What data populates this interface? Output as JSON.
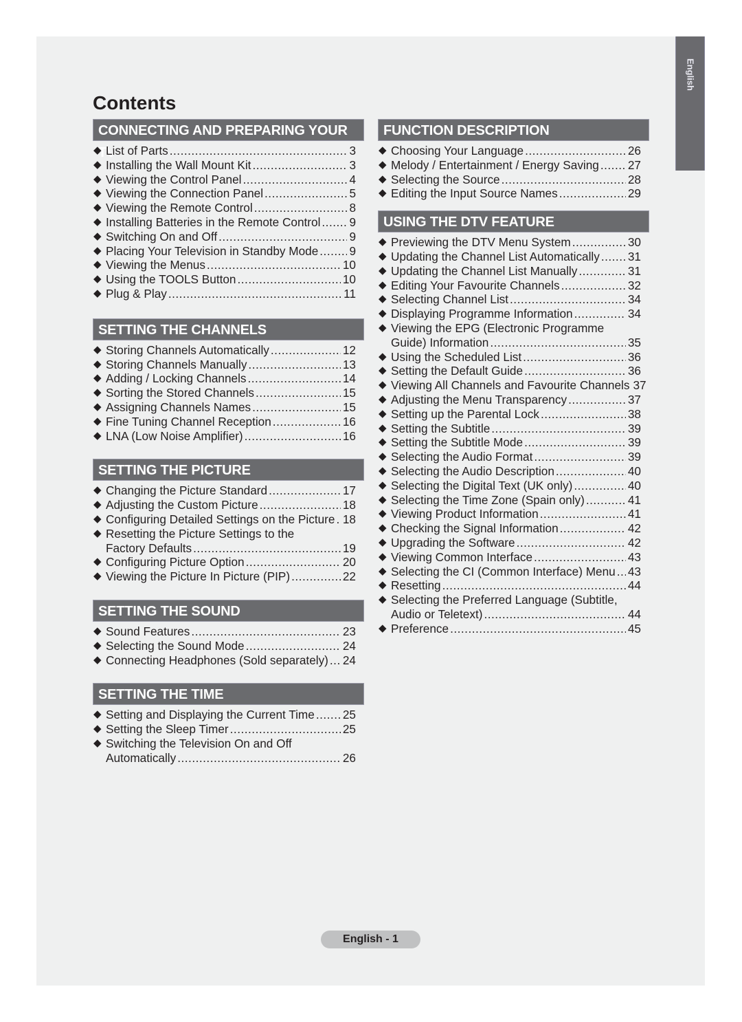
{
  "side_tab": "English",
  "title": "Contents",
  "footer": "English - 1",
  "left_sections": [
    {
      "heading": "CONNECTING AND PREPARING YOUR TV",
      "items": [
        {
          "text": "List of Parts",
          "page": "3"
        },
        {
          "text": "Installing the Wall Mount Kit",
          "page": "3"
        },
        {
          "text": "Viewing the Control Panel",
          "page": "4"
        },
        {
          "text": "Viewing the Connection Panel",
          "page": "5"
        },
        {
          "text": "Viewing the Remote Control",
          "page": "8"
        },
        {
          "text": "Installing Batteries in the Remote Control",
          "page": "9"
        },
        {
          "text": "Switching On and Off",
          "page": "9"
        },
        {
          "text": "Placing Your Television in Standby Mode",
          "page": "9"
        },
        {
          "text": "Viewing the Menus",
          "page": "10"
        },
        {
          "text": "Using the TOOLS Button",
          "page": "10"
        },
        {
          "text": "Plug & Play",
          "page": "11"
        }
      ]
    },
    {
      "heading": "SETTING THE CHANNELS",
      "items": [
        {
          "text": "Storing Channels Automatically",
          "page": "12"
        },
        {
          "text": "Storing Channels Manually",
          "page": "13"
        },
        {
          "text": "Adding / Locking Channels",
          "page": "14"
        },
        {
          "text": "Sorting the Stored Channels",
          "page": "15"
        },
        {
          "text": "Assigning Channels Names",
          "page": "15"
        },
        {
          "text": "Fine Tuning Channel Reception",
          "page": "16"
        },
        {
          "text": "LNA (Low Noise Amplifier)",
          "page": "16"
        }
      ]
    },
    {
      "heading": "SETTING THE PICTURE",
      "items": [
        {
          "text": "Changing the Picture Standard",
          "page": "17"
        },
        {
          "text": "Adjusting the Custom Picture",
          "page": "18"
        },
        {
          "text": "Configuring Detailed Settings on the Picture",
          "page": "18"
        },
        {
          "text": "Resetting the Picture Settings to the",
          "text2": "Factory Defaults",
          "page": "19"
        },
        {
          "text": "Configuring Picture Option",
          "page": "20"
        },
        {
          "text": "Viewing the Picture In Picture (PIP)",
          "page": "22"
        }
      ]
    },
    {
      "heading": "SETTING THE SOUND",
      "items": [
        {
          "text": "Sound Features",
          "page": "23"
        },
        {
          "text": "Selecting the Sound Mode",
          "page": "24"
        },
        {
          "text": "Connecting Headphones (Sold separately)",
          "page": "24"
        }
      ]
    },
    {
      "heading": "SETTING THE TIME",
      "items": [
        {
          "text": "Setting and Displaying the Current Time",
          "page": "25"
        },
        {
          "text": "Setting the Sleep Timer",
          "page": "25"
        },
        {
          "text": "Switching the Television On and Off",
          "text2": "Automatically",
          "page": "26"
        }
      ]
    }
  ],
  "right_sections": [
    {
      "heading": "FUNCTION DESCRIPTION",
      "items": [
        {
          "text": "Choosing Your Language",
          "page": "26"
        },
        {
          "text": "Melody / Entertainment / Energy Saving",
          "page": "27"
        },
        {
          "text": "Selecting the Source",
          "page": "28"
        },
        {
          "text": "Editing the Input Source Names",
          "page": "29"
        }
      ]
    },
    {
      "heading": "USING THE DTV FEATURE",
      "items": [
        {
          "text": "Previewing the DTV Menu System",
          "page": "30"
        },
        {
          "text": "Updating the Channel List Automatically",
          "page": "31"
        },
        {
          "text": "Updating the Channel List Manually",
          "page": "31"
        },
        {
          "text": "Editing Your Favourite Channels",
          "page": "32"
        },
        {
          "text": "Selecting Channel List",
          "page": "34"
        },
        {
          "text": "Displaying Programme Information",
          "page": "34"
        },
        {
          "text": "Viewing the EPG (Electronic Programme",
          "text2": "Guide) Information",
          "page": "35"
        },
        {
          "text": "Using the Scheduled List",
          "page": "36"
        },
        {
          "text": "Setting the Default Guide",
          "page": "36"
        },
        {
          "text": "Viewing All Channels and Favourite Channels",
          "page": "37"
        },
        {
          "text": "Adjusting the Menu Transparency",
          "page": "37"
        },
        {
          "text": "Setting up the Parental Lock",
          "page": "38"
        },
        {
          "text": "Setting the Subtitle",
          "page": "39"
        },
        {
          "text": "Setting the Subtitle Mode",
          "page": "39"
        },
        {
          "text": "Selecting the Audio Format",
          "page": "39"
        },
        {
          "text": "Selecting the Audio Description",
          "page": "40"
        },
        {
          "text": "Selecting the Digital Text (UK only)",
          "page": "40"
        },
        {
          "text": "Selecting the Time Zone (Spain only)",
          "page": "41"
        },
        {
          "text": "Viewing Product Information",
          "page": "41"
        },
        {
          "text": "Checking the Signal Information",
          "page": "42"
        },
        {
          "text": "Upgrading the Software",
          "page": "42"
        },
        {
          "text": "Viewing Common Interface",
          "page": "43"
        },
        {
          "text": "Selecting the CI (Common Interface) Menu",
          "page": "43"
        },
        {
          "text": "Resetting",
          "page": "44"
        },
        {
          "text": "Selecting the Preferred Language (Subtitle,",
          "text2": "Audio or Teletext)",
          "page": "44"
        },
        {
          "text": "Preference",
          "page": "45"
        }
      ]
    }
  ],
  "bullet_icon": "◆"
}
